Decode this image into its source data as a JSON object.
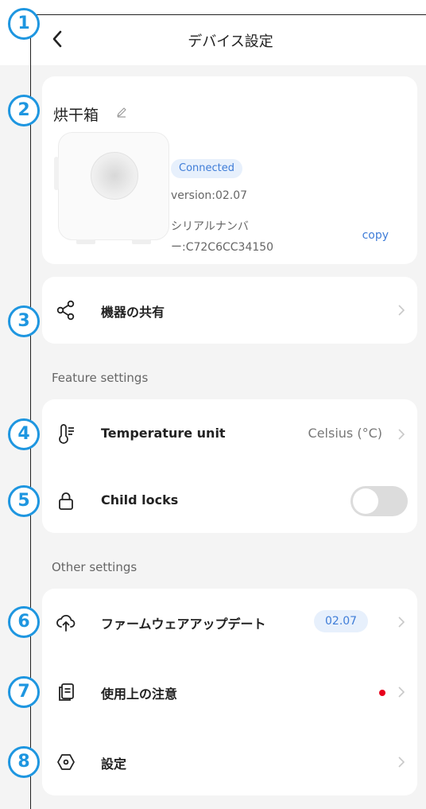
{
  "header": {
    "title": "デバイス設定",
    "back_icon": "chevron-left-icon"
  },
  "annotations": [
    "1",
    "2",
    "3",
    "4",
    "5",
    "6",
    "7",
    "8"
  ],
  "device": {
    "name": "烘干箱",
    "status": "Connected",
    "version": "version:02.07",
    "serial_line1": "シリアルナンバ",
    "serial_line2": "ー:C72C6CC34150",
    "copy_label": "copy"
  },
  "share": {
    "label": "機器の共有",
    "icon": "share-icon"
  },
  "feature_settings": {
    "section_label": "Feature settings",
    "temperature": {
      "label": "Temperature unit",
      "value": "Celsius (°C)",
      "icon": "thermometer-icon"
    },
    "child_lock": {
      "label": "Child locks",
      "enabled": false,
      "icon": "lock-icon"
    }
  },
  "other_settings": {
    "section_label": "Other settings",
    "firmware": {
      "label": "ファームウェアアップデート",
      "version": "02.07",
      "icon": "cloud-upload-icon"
    },
    "notes": {
      "label": "使用上の注意",
      "has_alert": true,
      "icon": "notes-icon"
    },
    "settings": {
      "label": "設定",
      "icon": "settings-hex-icon"
    }
  },
  "colors": {
    "accent": "#3f7dd8",
    "annotation": "#1e96e0",
    "alert": "#e8001c"
  }
}
